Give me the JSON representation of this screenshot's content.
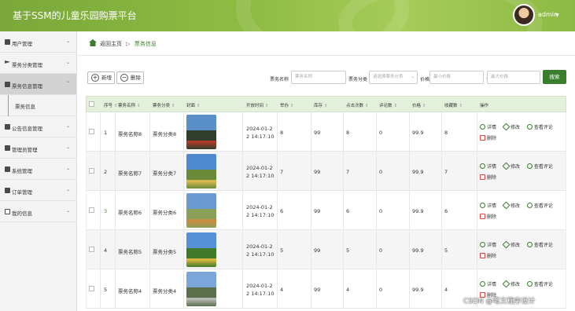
{
  "header": {
    "title": "基于SSM的儿童乐园购票平台",
    "user": "admin"
  },
  "sidebar": {
    "items": [
      {
        "label": "用户管理"
      },
      {
        "label": "票务分类管理"
      },
      {
        "label": "票务信息管理"
      },
      {
        "label": "票务信息"
      },
      {
        "label": "公告信息管理"
      },
      {
        "label": "管理员管理"
      },
      {
        "label": "系统管理"
      },
      {
        "label": "订单管理"
      },
      {
        "label": "我的信息"
      }
    ]
  },
  "breadcrumb": {
    "home": "返回主页",
    "current": "票务信息"
  },
  "toolbar": {
    "add_label": "新增",
    "delete_label": "删除"
  },
  "filters": {
    "name_label": "票务名称",
    "name_placeholder": "票务名称",
    "category_label": "票务分类",
    "category_placeholder": "请选择票务分类",
    "price_label": "价格",
    "min_placeholder": "最小价格",
    "max_placeholder": "最大价格",
    "search_label": "搜索"
  },
  "table": {
    "columns": [
      "序号",
      "票务名称",
      "票务分类",
      "封面",
      "开放时间",
      "举办",
      "库存",
      "点击次数",
      "评论数",
      "价格",
      "收藏数",
      "操作"
    ],
    "actions": {
      "detail": "详情",
      "edit": "修改",
      "comments": "查看评论",
      "delete": "删除"
    },
    "rows": [
      {
        "no": "1",
        "name": "票务名称8",
        "category": "票务分类8",
        "time": "2024-01-22 14:17:10",
        "hold": "8",
        "stock": "99",
        "clicks": "8",
        "comments": "0",
        "price": "99.9",
        "favorites": "8"
      },
      {
        "no": "2",
        "name": "票务名称7",
        "category": "票务分类7",
        "time": "2024-01-22 14:17:10",
        "hold": "7",
        "stock": "99",
        "clicks": "7",
        "comments": "0",
        "price": "99.9",
        "favorites": "7"
      },
      {
        "no": "3",
        "name": "票务名称6",
        "category": "票务分类6",
        "time": "2024-01-22 14:17:10",
        "hold": "6",
        "stock": "99",
        "clicks": "6",
        "comments": "0",
        "price": "99.9",
        "favorites": "6"
      },
      {
        "no": "4",
        "name": "票务名称5",
        "category": "票务分类5",
        "time": "2024-01-22 14:17:10",
        "hold": "5",
        "stock": "99",
        "clicks": "5",
        "comments": "0",
        "price": "99.9",
        "favorites": "5"
      },
      {
        "no": "5",
        "name": "票务名称4",
        "category": "票务分类4",
        "time": "2024-01-22 14:17:10",
        "hold": "4",
        "stock": "99",
        "clicks": "4",
        "comments": "0",
        "price": "99.9",
        "favorites": "4"
      }
    ]
  },
  "watermark": "CSDN @笔文程序设计"
}
